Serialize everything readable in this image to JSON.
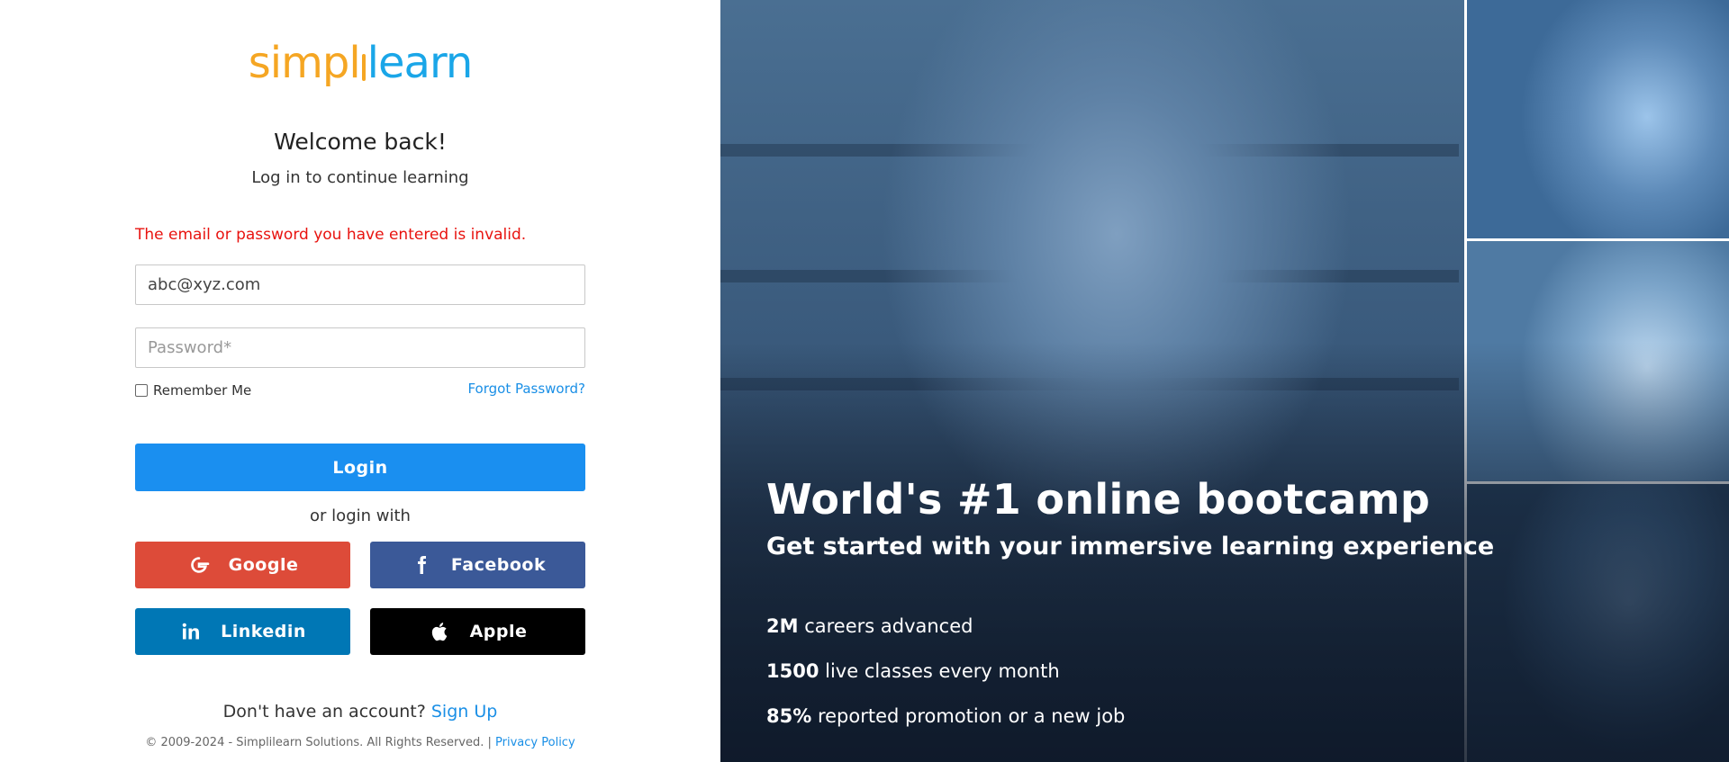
{
  "brand": {
    "logo_part1": "simpl",
    "logo_part2": "learn",
    "logo_colors": {
      "orange": "#f5a623",
      "blue": "#1aa6e8"
    }
  },
  "login": {
    "title": "Welcome back!",
    "subtitle": "Log in to continue learning",
    "error": "The email or password you have entered is invalid.",
    "email_value": "abc@xyz.com",
    "password_placeholder": "Password*",
    "remember_label": "Remember Me",
    "forgot_label": "Forgot Password?",
    "login_button": "Login",
    "or_text": "or login with",
    "social": {
      "google": "Google",
      "facebook": "Facebook",
      "linkedin": "Linkedin",
      "apple": "Apple"
    },
    "signup_prompt": "Don't have an account?",
    "signup_link": "Sign Up",
    "copyright": "© 2009-2024 - Simplilearn Solutions. All Rights Reserved. |",
    "privacy_link": "Privacy Policy"
  },
  "hero": {
    "headline": "World's #1 online bootcamp",
    "subhead": "Get started with your immersive learning experience",
    "stats": [
      {
        "value": "2M",
        "label": "careers advanced"
      },
      {
        "value": "1500",
        "label": "live classes every month"
      },
      {
        "value": "85%",
        "label": "reported promotion or a new job"
      }
    ]
  },
  "colors": {
    "primary": "#1a8ff0",
    "error": "#e8130f",
    "google": "#dd4b39",
    "facebook": "#3b5998",
    "linkedin": "#0077b5",
    "apple": "#000000"
  }
}
